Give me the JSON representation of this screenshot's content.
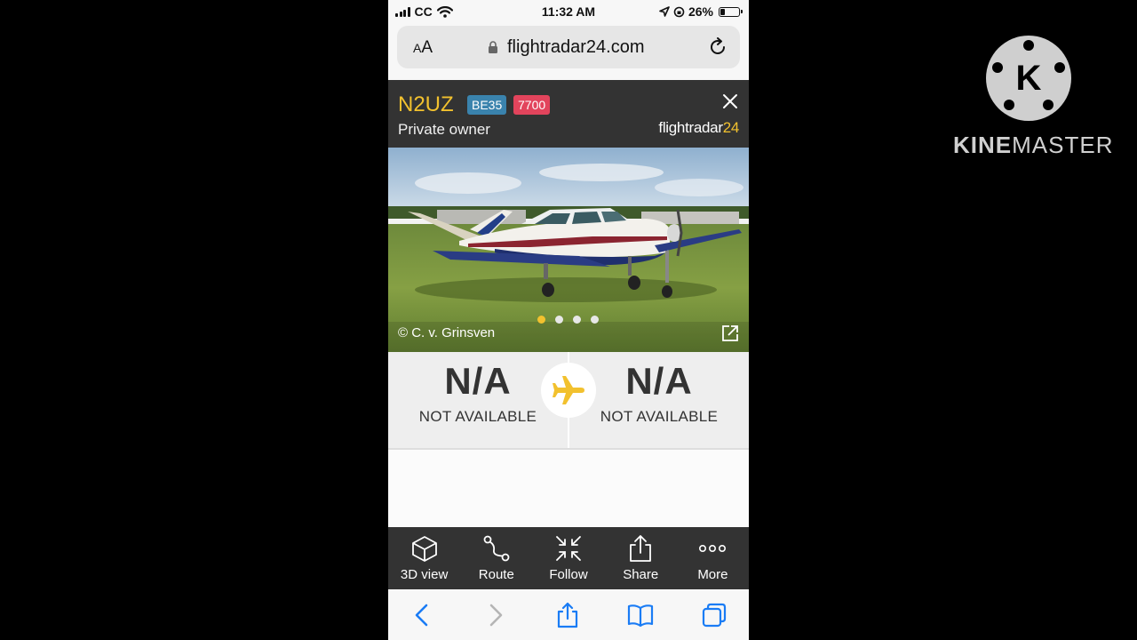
{
  "status_bar": {
    "carrier": "CC",
    "time": "11:32 AM",
    "battery": "26%",
    "battery_level": 0.26
  },
  "address_bar": {
    "aa_small": "A",
    "aa_large": "A",
    "url": "flightradar24.com"
  },
  "aircraft": {
    "registration": "N2UZ",
    "type_code": "BE35",
    "squawk": "7700",
    "operator": "Private owner",
    "logo_text": "flightradar",
    "logo_num": "24",
    "photo_credit": "© C. v. Grinsven",
    "photo_count": 4,
    "photo_active_index": 0
  },
  "route": {
    "origin": {
      "code": "N/A",
      "name": "NOT AVAILABLE"
    },
    "destination": {
      "code": "N/A",
      "name": "NOT AVAILABLE"
    }
  },
  "toolbar": [
    {
      "label": "3D view",
      "icon": "cube-icon"
    },
    {
      "label": "Route",
      "icon": "route-icon"
    },
    {
      "label": "Follow",
      "icon": "follow-arrows-icon"
    },
    {
      "label": "Share",
      "icon": "share-icon"
    },
    {
      "label": "More",
      "icon": "more-dots-icon"
    }
  ],
  "colors": {
    "accent_yellow": "#f2c12e",
    "type_badge": "#3a83ad",
    "squawk_badge": "#e2445c",
    "panel_dark": "#333333",
    "safari_blue": "#1a7cf5"
  },
  "watermark": {
    "brand_bold": "KINE",
    "brand_light": "MASTER",
    "logo_letter": "K"
  }
}
